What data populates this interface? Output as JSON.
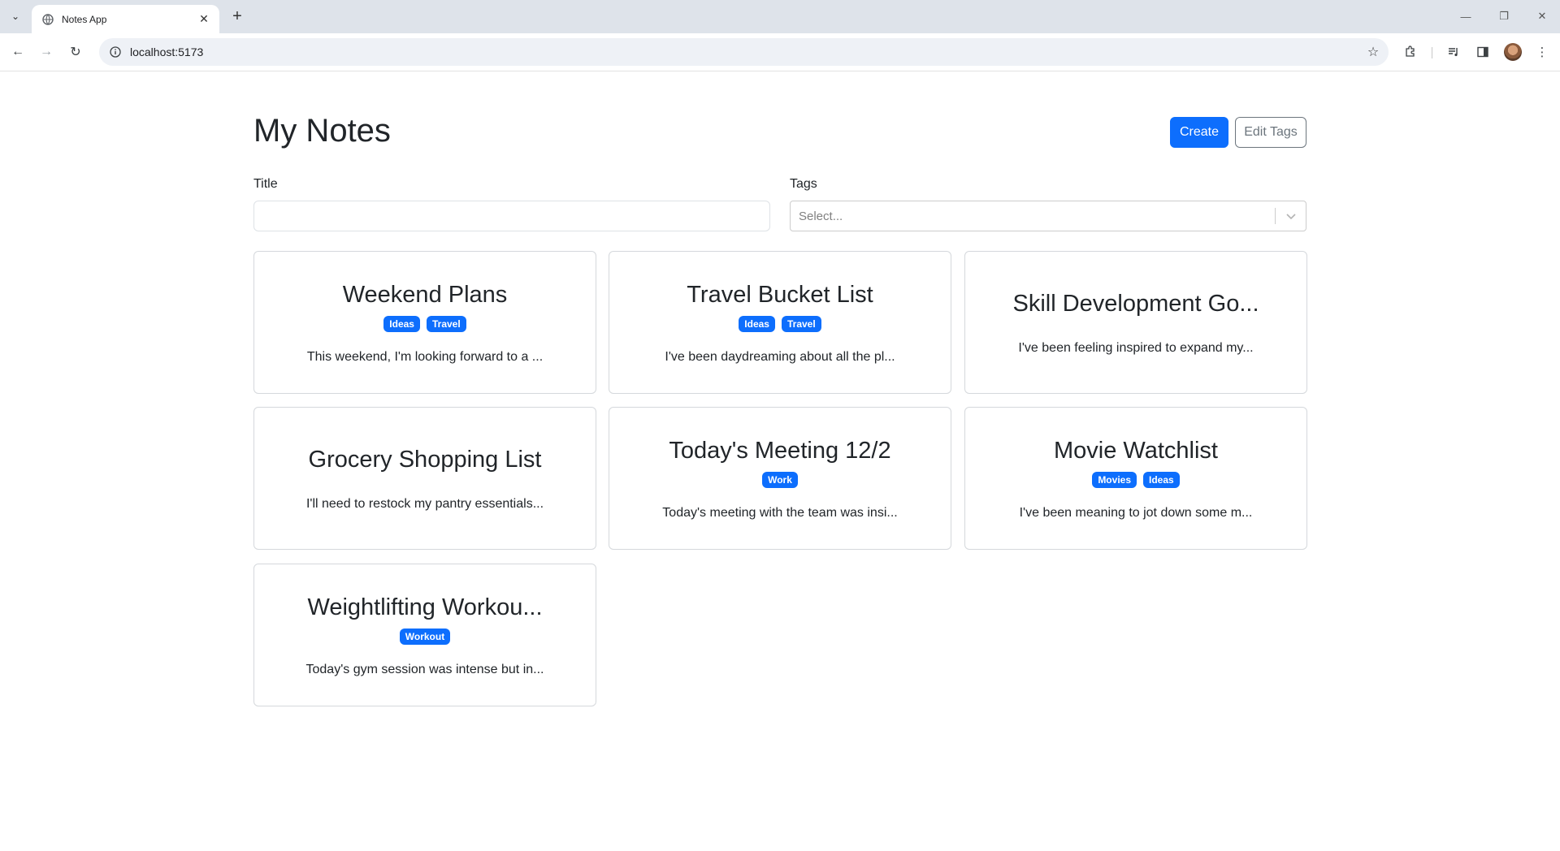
{
  "browser": {
    "tab_title": "Notes App",
    "url": "localhost:5173"
  },
  "header": {
    "title": "My Notes",
    "create_label": "Create",
    "edit_tags_label": "Edit Tags"
  },
  "filters": {
    "title_label": "Title",
    "title_value": "",
    "tags_label": "Tags",
    "tags_placeholder": "Select..."
  },
  "notes": [
    {
      "title": "Weekend Plans",
      "tags": [
        "Ideas",
        "Travel"
      ],
      "body": "This weekend, I'm looking forward to a ..."
    },
    {
      "title": "Travel Bucket List",
      "tags": [
        "Ideas",
        "Travel"
      ],
      "body": "I've been daydreaming about all the pl..."
    },
    {
      "title": "Skill Development Go...",
      "tags": [],
      "body": "I've been feeling inspired to expand my..."
    },
    {
      "title": "Grocery Shopping List",
      "tags": [],
      "body": "I'll need to restock my pantry essentials..."
    },
    {
      "title": "Today's Meeting 12/2",
      "tags": [
        "Work"
      ],
      "body": "Today's meeting with the team was insi..."
    },
    {
      "title": "Movie Watchlist",
      "tags": [
        "Movies",
        "Ideas"
      ],
      "body": "I've been meaning to jot down some m..."
    },
    {
      "title": "Weightlifting Workou...",
      "tags": [
        "Workout"
      ],
      "body": "Today's gym session was intense but in..."
    }
  ],
  "colors": {
    "primary": "#0d6efd",
    "secondary": "#6c757d",
    "text": "#212529",
    "chrome": "#dee3ea"
  }
}
